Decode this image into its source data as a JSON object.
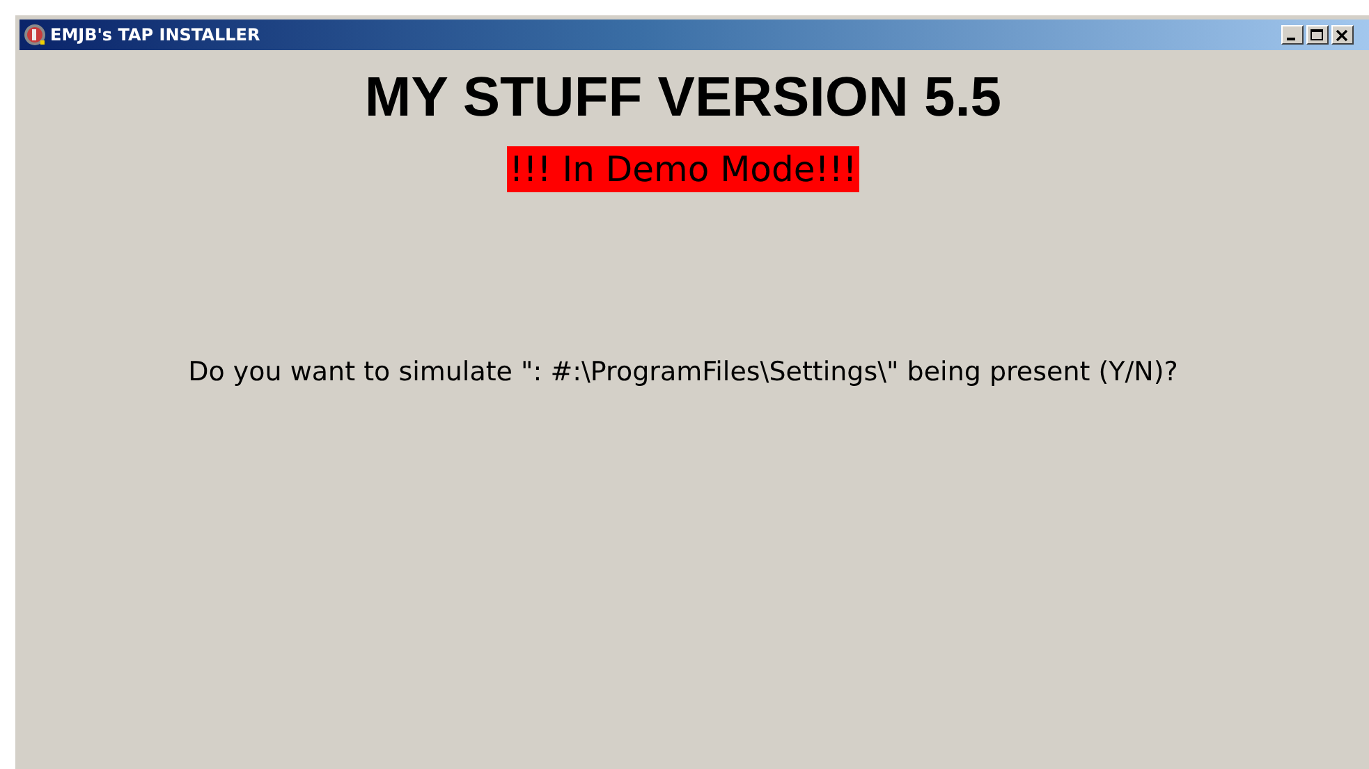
{
  "window": {
    "title": "EMJB's TAP INSTALLER"
  },
  "heading": "MY STUFF VERSION 5.5",
  "demo_banner": "!!! In Demo Mode!!!",
  "prompt": "Do you want to simulate \": #:\\ProgramFiles\\Settings\\\" being present (Y/N)?"
}
